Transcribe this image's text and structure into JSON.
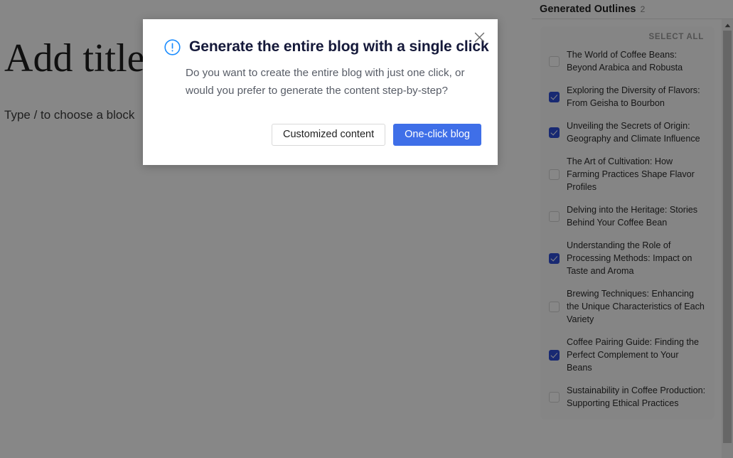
{
  "editor": {
    "title_placeholder": "Add title",
    "block_placeholder": "Type / to choose a block"
  },
  "outlines_panel": {
    "header_title": "Generated Outlines",
    "header_count": "2",
    "select_all_label": "SELECT ALL",
    "items": [
      {
        "text": "The World of Coffee Beans: Beyond Arabica and Robusta",
        "checked": false
      },
      {
        "text": "Exploring the Diversity of Flavors: From Geisha to Bourbon",
        "checked": true
      },
      {
        "text": "Unveiling the Secrets of Origin: Geography and Climate Influence",
        "checked": true
      },
      {
        "text": "The Art of Cultivation: How Farming Practices Shape Flavor Profiles",
        "checked": false
      },
      {
        "text": "Delving into the Heritage: Stories Behind Your Coffee Bean",
        "checked": false
      },
      {
        "text": "Understanding the Role of Processing Methods: Impact on Taste and Aroma",
        "checked": true
      },
      {
        "text": "Brewing Techniques: Enhancing the Unique Characteristics of Each Variety",
        "checked": false
      },
      {
        "text": "Coffee Pairing Guide: Finding the Perfect Complement to Your Beans",
        "checked": true
      },
      {
        "text": "Sustainability in Coffee Production: Supporting Ethical Practices",
        "checked": false
      }
    ]
  },
  "modal": {
    "title": "Generate the entire blog with a single click",
    "description": "Do you want to create the entire blog with just one click, or would you prefer to generate the content step-by-step?",
    "close_icon": "close-icon",
    "info_icon": "info-circle-icon",
    "secondary_button": "Customized content",
    "primary_button": "One-click blog",
    "primary_color": "#3f6fe8"
  },
  "colors": {
    "overlay": "rgba(0,0,0,0.47)",
    "checkbox_checked": "#2f4fd8",
    "info_icon": "#1a8cff"
  }
}
